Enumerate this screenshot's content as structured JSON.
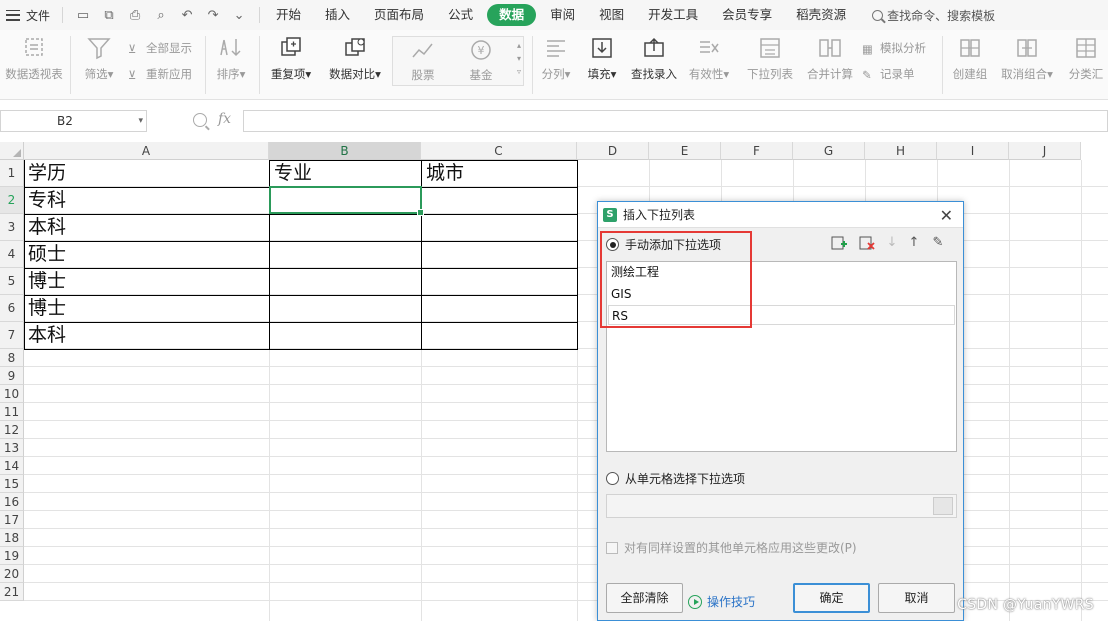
{
  "menubar": {
    "file_label": "文件",
    "tabs": [
      "开始",
      "插入",
      "页面布局",
      "公式",
      "数据",
      "审阅",
      "视图",
      "开发工具",
      "会员专享",
      "稻壳资源"
    ],
    "active_tab": "数据",
    "search_label": "查找命令、搜索模板"
  },
  "ribbon": {
    "pivot": "数据透视表",
    "filter": "筛选",
    "show_all": "全部显示",
    "reapply": "重新应用",
    "sort": "排序",
    "duplicates": "重复项",
    "compare": "数据对比",
    "stock": "股票",
    "fund": "基金",
    "split": "分列",
    "fill": "填充",
    "lookup": "查找录入",
    "validity": "有效性",
    "dropdown": "下拉列表",
    "consolidate": "合并计算",
    "simulate": "模拟分析",
    "record": "记录单",
    "group": "创建组",
    "ungroup": "取消组合",
    "subtotal": "分类汇"
  },
  "formula_bar": {
    "namebox": "B2",
    "fx": "fx",
    "value": ""
  },
  "sheet": {
    "columns": [
      "A",
      "B",
      "C",
      "D",
      "E",
      "F",
      "G",
      "H",
      "I",
      "J"
    ],
    "rows": [
      "1",
      "2",
      "3",
      "4",
      "5",
      "6",
      "7",
      "8",
      "9",
      "10",
      "11",
      "12",
      "13",
      "14",
      "15",
      "16",
      "17",
      "18",
      "19",
      "20",
      "21"
    ],
    "selected_cell": "B2",
    "cells": {
      "A1": "学历",
      "B1": "专业",
      "C1": "城市",
      "A2": "专科",
      "A3": "本科",
      "A4": "硕士",
      "A5": "博士",
      "A6": "博士",
      "A7": "本科"
    }
  },
  "dialog": {
    "title": "插入下拉列表",
    "manual_option": "手动添加下拉选项",
    "items": [
      "测绘工程",
      "GIS",
      "RS"
    ],
    "from_cells_option": "从单元格选择下拉选项",
    "apply_same": "对有同样设置的其他单元格应用这些更改(P)",
    "clear_all": "全部清除",
    "tips": "操作技巧",
    "ok": "确定",
    "cancel": "取消"
  },
  "watermark": "CSDN @YuanYWRS",
  "colors": {
    "accent_green": "#27a35b",
    "dialog_border": "#3b8fd6",
    "highlight_red": "#e53935"
  }
}
